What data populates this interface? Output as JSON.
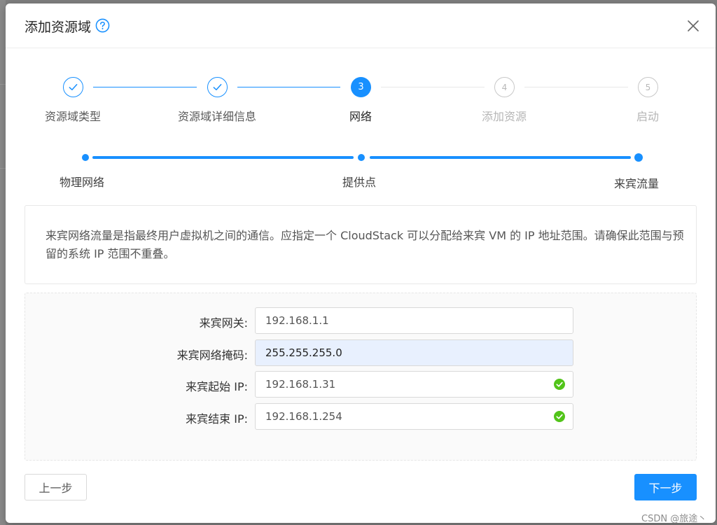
{
  "dialog": {
    "title": "添加资源域"
  },
  "steps": [
    {
      "label": "资源域类型",
      "status": "done"
    },
    {
      "label": "资源域详细信息",
      "status": "done"
    },
    {
      "label": "网络",
      "status": "current",
      "number": "3"
    },
    {
      "label": "添加资源",
      "status": "wait",
      "number": "4"
    },
    {
      "label": "启动",
      "status": "wait",
      "number": "5"
    }
  ],
  "substeps": [
    {
      "label": "物理网络"
    },
    {
      "label": "提供点"
    },
    {
      "label": "来宾流量"
    }
  ],
  "info": {
    "text": "来宾网络流量是指最终用户虚拟机之间的通信。应指定一个 CloudStack 可以分配给来宾 VM 的 IP 地址范围。请确保此范围与预留的系统 IP 范围不重叠。"
  },
  "form": {
    "gateway": {
      "label": "来宾网关:",
      "value": "192.168.1.1"
    },
    "netmask": {
      "label": "来宾网络掩码:",
      "value": "255.255.255.0"
    },
    "start_ip": {
      "label": "来宾起始 IP:",
      "value": "192.168.1.31"
    },
    "end_ip": {
      "label": "来宾结束 IP:",
      "value": "192.168.1.254"
    }
  },
  "footer": {
    "prev_label": "上一步",
    "next_label": "下一步"
  },
  "watermark": "CSDN @旅途丶",
  "colors": {
    "primary": "#1890ff",
    "success": "#52c41a",
    "autofill": "#e8f0fe"
  },
  "icons": {
    "help": "question-circle-icon",
    "close": "close-icon",
    "done_step": "check-icon",
    "valid": "check-circle-icon"
  }
}
